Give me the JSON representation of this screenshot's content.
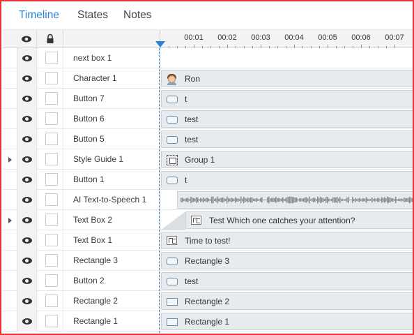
{
  "tabs": [
    {
      "label": "Timeline",
      "active": true
    },
    {
      "label": "States",
      "active": false
    },
    {
      "label": "Notes",
      "active": false
    }
  ],
  "header": {
    "eye_icon": "eye-icon",
    "lock_icon": "lock-icon",
    "ticks": [
      "00:01",
      "00:02",
      "00:03",
      "00:04",
      "00:05",
      "00:06",
      "00:07"
    ]
  },
  "rows": [
    {
      "name": "next box 1",
      "expandable": false,
      "bar": null
    },
    {
      "name": "Character 1",
      "expandable": false,
      "bar": {
        "label": "Ron",
        "icon": "character-icon"
      }
    },
    {
      "name": "Button 7",
      "expandable": false,
      "bar": {
        "label": "t",
        "icon": "button-shape-icon"
      }
    },
    {
      "name": "Button 6",
      "expandable": false,
      "bar": {
        "label": "test",
        "icon": "button-shape-icon"
      }
    },
    {
      "name": "Button 5",
      "expandable": false,
      "bar": {
        "label": "test",
        "icon": "button-shape-icon"
      }
    },
    {
      "name": "Style Guide 1",
      "expandable": true,
      "bar": {
        "label": "Group 1",
        "icon": "group-icon"
      }
    },
    {
      "name": "Button 1",
      "expandable": false,
      "bar": {
        "label": "t",
        "icon": "button-shape-icon"
      }
    },
    {
      "name": "AI Text-to-Speech 1",
      "expandable": false,
      "bar": {
        "label": "",
        "icon": "audio-waveform"
      }
    },
    {
      "name": "Text Box 2",
      "expandable": true,
      "bar": {
        "label": "Test Which one catches your attention?",
        "icon": "text-box-icon",
        "delayed": true
      }
    },
    {
      "name": "Text Box 1",
      "expandable": false,
      "bar": {
        "label": "Time to test!",
        "icon": "text-box-icon"
      }
    },
    {
      "name": "Rectangle 3",
      "expandable": false,
      "bar": {
        "label": "Rectangle 3",
        "icon": "button-shape-icon"
      }
    },
    {
      "name": "Button 2",
      "expandable": false,
      "bar": {
        "label": "test",
        "icon": "button-shape-icon"
      }
    },
    {
      "name": "Rectangle 2",
      "expandable": false,
      "bar": {
        "label": "Rectangle 2",
        "icon": "rectangle-icon"
      }
    },
    {
      "name": "Rectangle 1",
      "expandable": false,
      "bar": {
        "label": "Rectangle 1",
        "icon": "rectangle-icon"
      }
    }
  ],
  "colors": {
    "accent": "#2a82d2",
    "frame_border": "#e8313b",
    "bar_fill": "#e7ebee",
    "waveform": "#8c8c8c"
  }
}
